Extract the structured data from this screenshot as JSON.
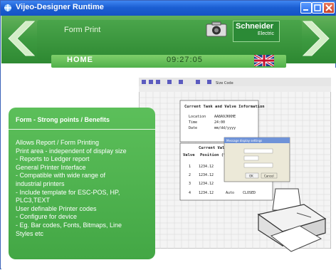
{
  "window": {
    "title": "Vijeo-Designer Runtime"
  },
  "header": {
    "screen_title": "Form Print",
    "home_label": "HOME",
    "clock": "09:27:05",
    "brand": {
      "name": "Schneider",
      "sub": "Electric"
    }
  },
  "colors": {
    "green_bar": "#3d9a40",
    "box_green": "#4caf4a",
    "titlebar": "#1c5fd3"
  },
  "icons": {
    "left": "arrow-left-icon",
    "right": "arrow-right-icon",
    "camera": "camera-icon",
    "printer": "printer-icon",
    "flag": "uk-flag-icon"
  },
  "info": {
    "heading": "Form - Strong points / Benefits",
    "lines": [
      "Allows Report / Form Printing",
      "Print area - independent of display size",
      "- Reports to Ledger report",
      "General Printer Interface",
      "- Compatible with wide range of",
      "industrial printers",
      "- Include template for ESC-POS, HP,",
      "PLC3,TEXT",
      "User definable Printer codes",
      "- Configure for device",
      "- Eg. Bar codes, Fonts, Bitmaps, Line",
      "Styles etc"
    ]
  },
  "document": {
    "heading": "Current Tank and Valve Information",
    "fields": [
      {
        "label": "Location",
        "value": "AA8A9JKKHE"
      },
      {
        "label": "Time",
        "value": "24:00"
      },
      {
        "label": "Date",
        "value": "mm/dd/yyyy"
      }
    ],
    "table_title": "Current Valve",
    "columns": [
      "Valve",
      "Position (%"
    ],
    "rows": [
      {
        "valve": "1",
        "pos": "1234.12"
      },
      {
        "valve": "2",
        "pos": "1234.12"
      },
      {
        "valve": "3",
        "pos": "1234.12"
      },
      {
        "valve": "4",
        "pos": "1234.12",
        "mode": "Auto",
        "state": "CLOSED"
      }
    ],
    "dialog": {
      "title": "Message display settings",
      "ok": "OK",
      "cancel": "Cancel"
    },
    "toolbar_size": "Size Code"
  }
}
